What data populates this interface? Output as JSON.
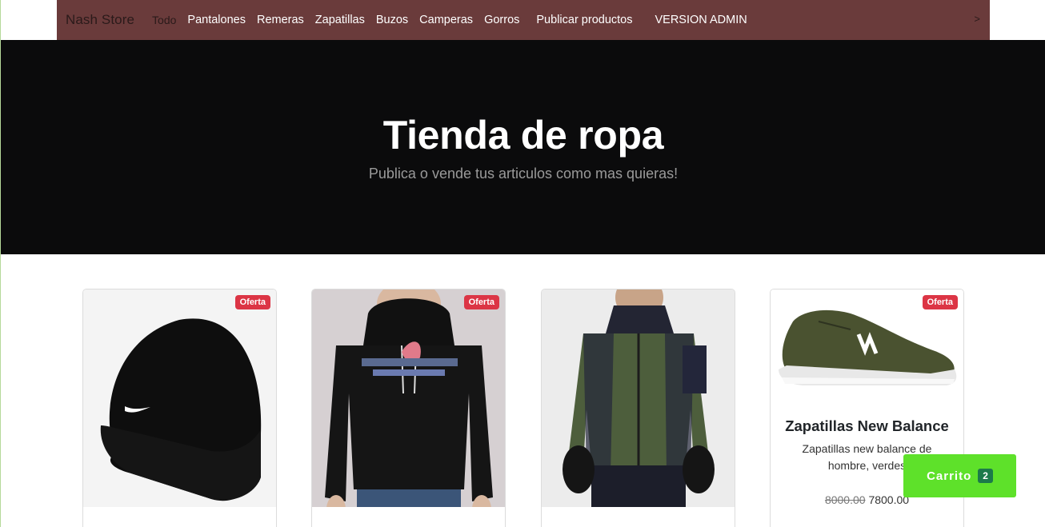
{
  "navbar": {
    "brand": "Nash Store",
    "links": [
      "Todo",
      "Pantalones",
      "Remeras",
      "Zapatillas",
      "Buzos",
      "Camperas",
      "Gorros"
    ],
    "publish": "Publicar productos",
    "admin": "VERSION ADMIN",
    "toggle": ">"
  },
  "hero": {
    "title": "Tienda de ropa",
    "subtitle": "Publica o vende tus articulos como mas quieras!"
  },
  "products": [
    {
      "image": "black-beanie-image",
      "badge": "Oferta"
    },
    {
      "image": "black-hoodie-image",
      "badge": "Oferta"
    },
    {
      "image": "green-jacket-image",
      "badge": ""
    },
    {
      "image": "green-sneaker-image",
      "badge": "Oferta",
      "title": "Zapatillas New Balance",
      "description": "Zapatillas new balance de hombre, verdes",
      "old_price": "8000.00",
      "price": "7800.00"
    }
  ],
  "cart": {
    "label": "Carrito",
    "count": "2"
  },
  "colors": {
    "navbar": "#6a3b3b",
    "hero": "#0b0b0c",
    "badge": "#dc3545",
    "cart": "#5ee12a"
  }
}
